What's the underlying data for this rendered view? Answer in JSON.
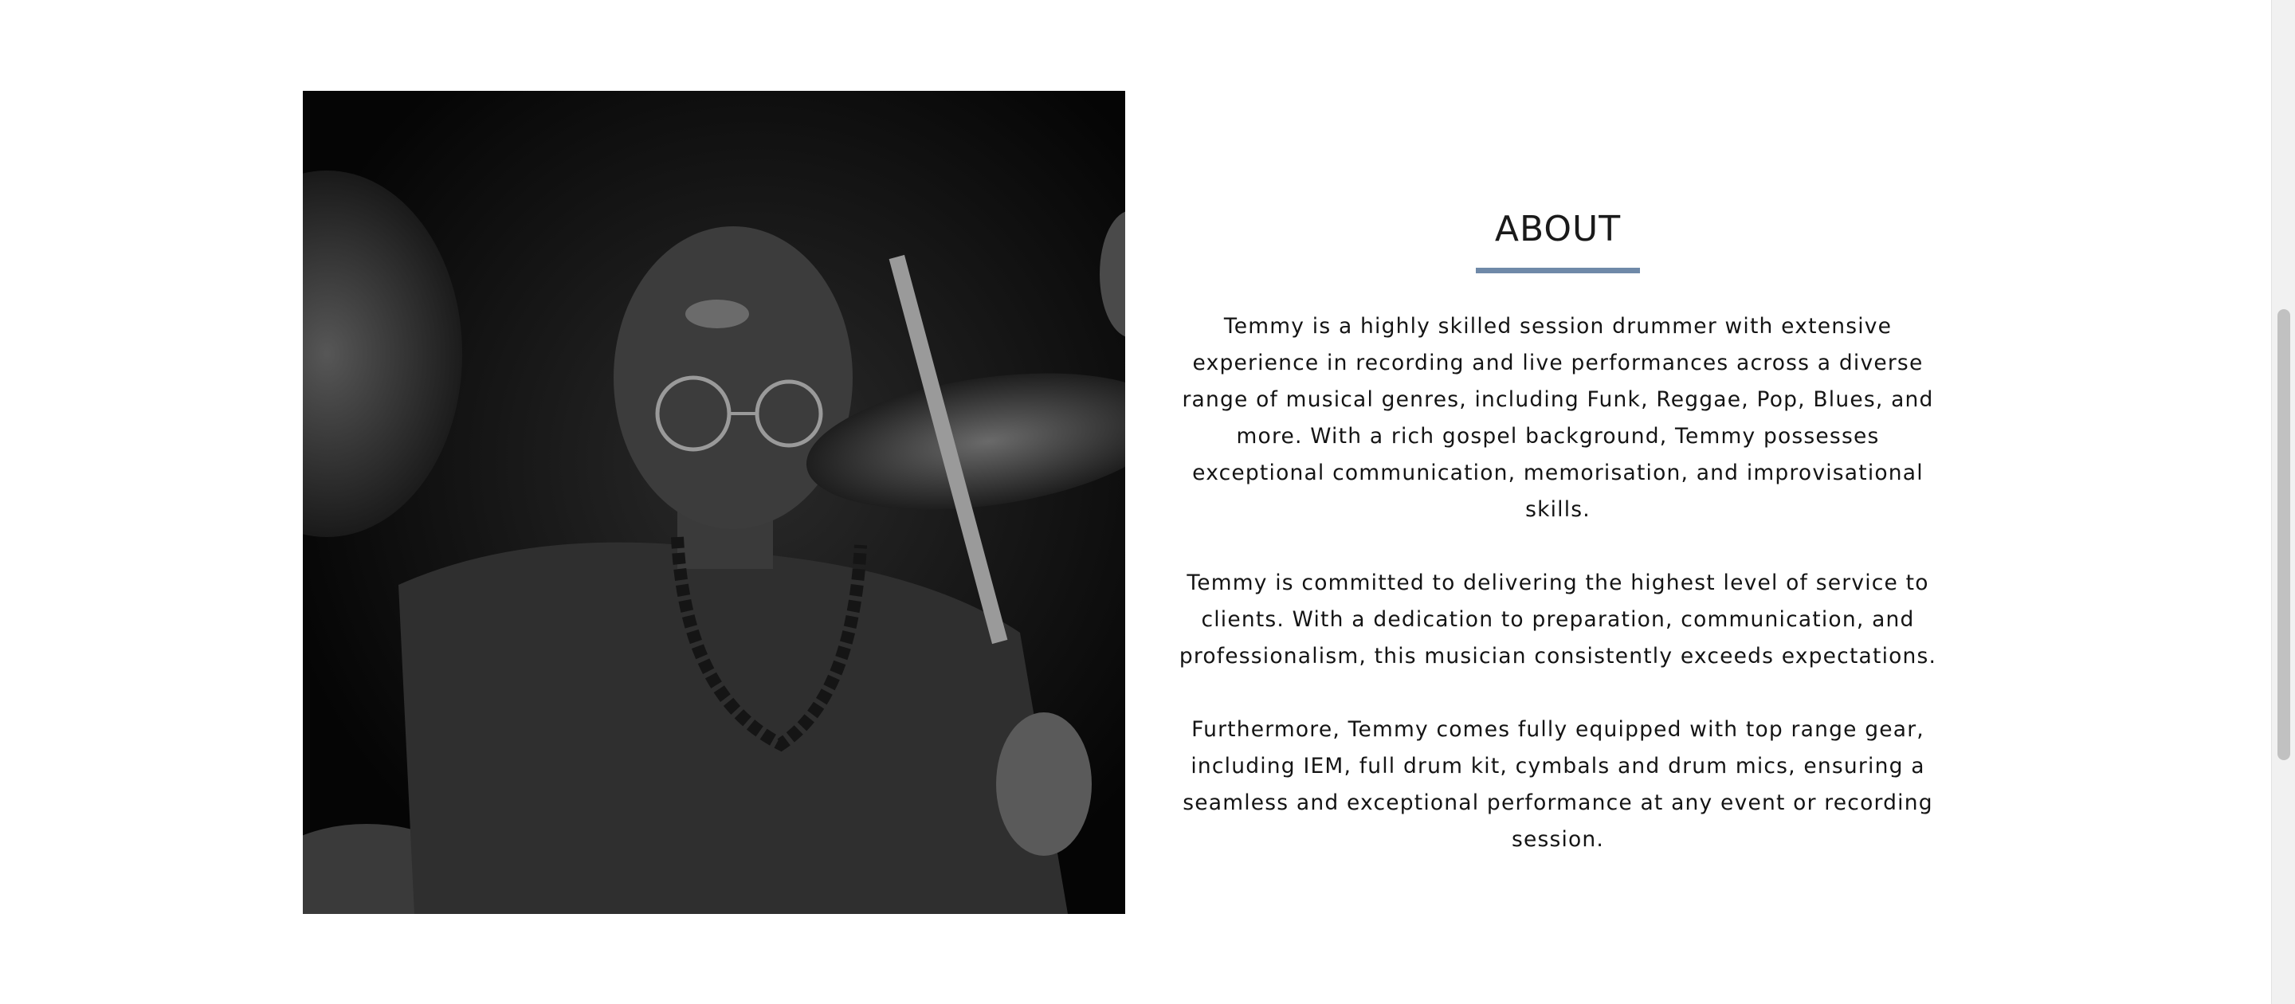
{
  "about": {
    "title": "ABOUT",
    "accent_color": "#6f89a8",
    "paragraphs": [
      "Temmy is a highly skilled session drummer with extensive experience in recording and live performances across a diverse range of musical genres, including Funk, Reggae, Pop, Blues, and more. With a rich gospel background, Temmy possesses exceptional communication, memorisation, and improvisational skills.",
      "Temmy is committed to delivering the highest level of service to clients. With a dedication to preparation, communication, and professionalism, this musician consistently exceeds expectations.",
      "Furthermore, Temmy comes fully equipped with top range gear, including IEM, full drum kit, cymbals and drum mics, ensuring a seamless and exceptional performance at any event or recording session."
    ]
  },
  "photo": {
    "subject": "drummer-photo"
  }
}
